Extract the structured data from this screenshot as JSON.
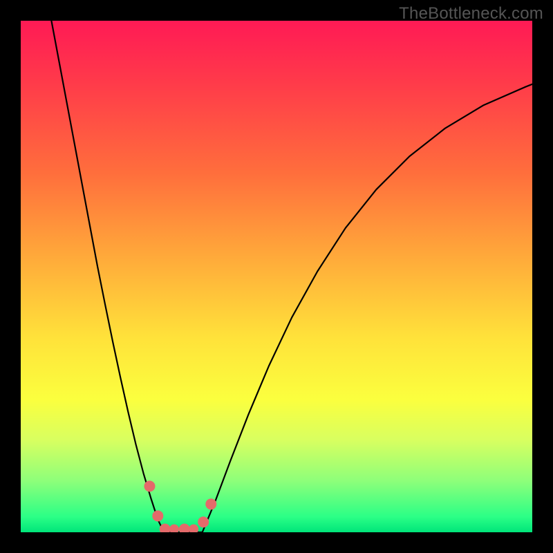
{
  "watermark": "TheBottleneck.com",
  "chart_data": {
    "type": "line",
    "title": "",
    "xlabel": "",
    "ylabel": "",
    "xlim": [
      0,
      1
    ],
    "ylim": [
      0,
      1
    ],
    "gradient_stops": [
      {
        "offset": 0.0,
        "color": "#ff1a55"
      },
      {
        "offset": 0.12,
        "color": "#ff3a4a"
      },
      {
        "offset": 0.3,
        "color": "#ff6f3c"
      },
      {
        "offset": 0.48,
        "color": "#ffb03a"
      },
      {
        "offset": 0.62,
        "color": "#ffe23a"
      },
      {
        "offset": 0.74,
        "color": "#fbff3e"
      },
      {
        "offset": 0.82,
        "color": "#d8ff60"
      },
      {
        "offset": 0.9,
        "color": "#8dff7a"
      },
      {
        "offset": 0.97,
        "color": "#2bff86"
      },
      {
        "offset": 1.0,
        "color": "#00e57a"
      }
    ],
    "series": [
      {
        "name": "left-branch",
        "x": [
          0.06,
          0.075,
          0.09,
          0.105,
          0.12,
          0.135,
          0.15,
          0.165,
          0.18,
          0.195,
          0.21,
          0.225,
          0.24,
          0.255,
          0.268,
          0.28
        ],
        "y": [
          1.0,
          0.92,
          0.84,
          0.76,
          0.68,
          0.6,
          0.52,
          0.445,
          0.372,
          0.302,
          0.235,
          0.172,
          0.115,
          0.065,
          0.025,
          0.0
        ]
      },
      {
        "name": "valley-floor",
        "x": [
          0.28,
          0.295,
          0.31,
          0.325,
          0.34,
          0.355
        ],
        "y": [
          0.0,
          0.0,
          0.0,
          0.0,
          0.0,
          0.0
        ]
      },
      {
        "name": "right-branch",
        "x": [
          0.355,
          0.38,
          0.41,
          0.445,
          0.485,
          0.53,
          0.58,
          0.635,
          0.695,
          0.76,
          0.83,
          0.905,
          0.985,
          1.0
        ],
        "y": [
          0.0,
          0.06,
          0.14,
          0.23,
          0.325,
          0.42,
          0.51,
          0.595,
          0.67,
          0.735,
          0.79,
          0.835,
          0.87,
          0.876
        ]
      }
    ],
    "markers": [
      {
        "x": 0.252,
        "y": 0.09,
        "r": 8
      },
      {
        "x": 0.268,
        "y": 0.032,
        "r": 8
      },
      {
        "x": 0.282,
        "y": 0.006,
        "r": 8
      },
      {
        "x": 0.3,
        "y": 0.006,
        "r": 7
      },
      {
        "x": 0.32,
        "y": 0.006,
        "r": 8
      },
      {
        "x": 0.338,
        "y": 0.006,
        "r": 7
      },
      {
        "x": 0.357,
        "y": 0.02,
        "r": 8
      },
      {
        "x": 0.372,
        "y": 0.055,
        "r": 8
      }
    ],
    "marker_color": "#e46a6a",
    "curve_color": "#000000",
    "curve_width": 2.2
  }
}
